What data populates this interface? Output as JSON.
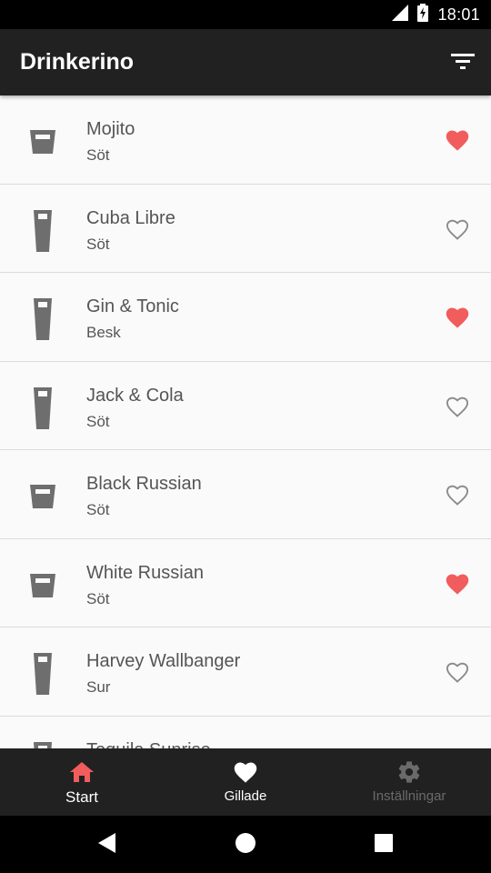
{
  "status_bar": {
    "time": "18:01"
  },
  "app_bar": {
    "title": "Drinkerino",
    "filter_icon": "filter-icon"
  },
  "colors": {
    "accent": "#f15c5c",
    "app_bar": "#212121",
    "text": "#555555",
    "icon": "#6e6e6e",
    "disabled": "#6a6a6a"
  },
  "drinks": [
    {
      "name": "Mojito",
      "taste": "Söt",
      "glass": "rocks-glass-icon",
      "favorite": true
    },
    {
      "name": "Cuba Libre",
      "taste": "Söt",
      "glass": "highball-glass-icon",
      "favorite": false
    },
    {
      "name": "Gin & Tonic",
      "taste": "Besk",
      "glass": "highball-glass-icon",
      "favorite": true
    },
    {
      "name": "Jack & Cola",
      "taste": "Söt",
      "glass": "highball-glass-icon",
      "favorite": false
    },
    {
      "name": "Black Russian",
      "taste": "Söt",
      "glass": "rocks-glass-icon",
      "favorite": false
    },
    {
      "name": "White Russian",
      "taste": "Söt",
      "glass": "rocks-glass-icon",
      "favorite": true
    },
    {
      "name": "Harvey Wallbanger",
      "taste": "Sur",
      "glass": "highball-glass-icon",
      "favorite": false
    },
    {
      "name": "Tequila Sunrise",
      "taste": "",
      "glass": "highball-glass-icon",
      "favorite": false
    }
  ],
  "bottom_nav": [
    {
      "label": "Start",
      "icon": "home-icon",
      "state": "active"
    },
    {
      "label": "Gillade",
      "icon": "heart-icon",
      "state": "normal"
    },
    {
      "label": "Inställningar",
      "icon": "gear-icon",
      "state": "disabled"
    }
  ],
  "system_nav": {
    "back": "back-icon",
    "home": "home-circle-icon",
    "recents": "recents-icon"
  }
}
